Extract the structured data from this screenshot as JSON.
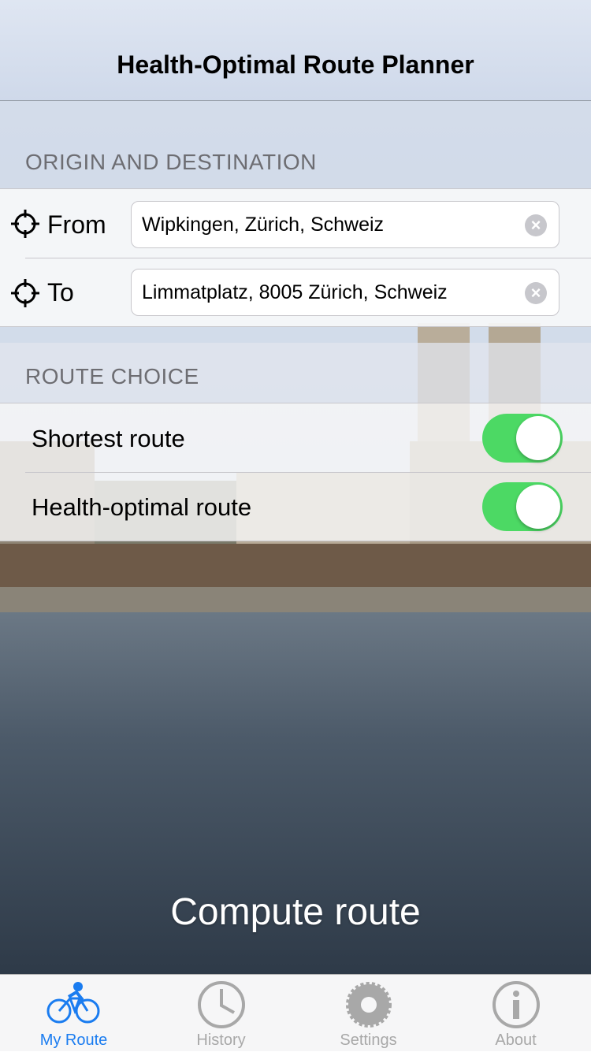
{
  "nav": {
    "title": "Health-Optimal Route Planner"
  },
  "origin_section": {
    "header": "ORIGIN AND DESTINATION",
    "from": {
      "label": "From",
      "value": "Wipkingen, Zürich, Schweiz",
      "icon": "crosshair-icon"
    },
    "to": {
      "label": "To",
      "value": "Limmatplatz, 8005 Zürich, Schweiz",
      "icon": "crosshair-icon"
    },
    "clear_glyph": "×"
  },
  "route_section": {
    "header": "ROUTE CHOICE",
    "options": [
      {
        "label": "Shortest route",
        "on": true
      },
      {
        "label": "Health-optimal route",
        "on": true
      }
    ]
  },
  "compute_label": "Compute route",
  "tabs": [
    {
      "label": "My Route",
      "icon": "bicycle-icon",
      "active": true
    },
    {
      "label": "History",
      "icon": "clock-icon",
      "active": false
    },
    {
      "label": "Settings",
      "icon": "gear-icon",
      "active": false
    },
    {
      "label": "About",
      "icon": "info-icon",
      "active": false
    }
  ],
  "colors": {
    "accent": "#1a7cf0",
    "toggle_on": "#4cd964",
    "tab_inactive": "#a8a8a8"
  }
}
